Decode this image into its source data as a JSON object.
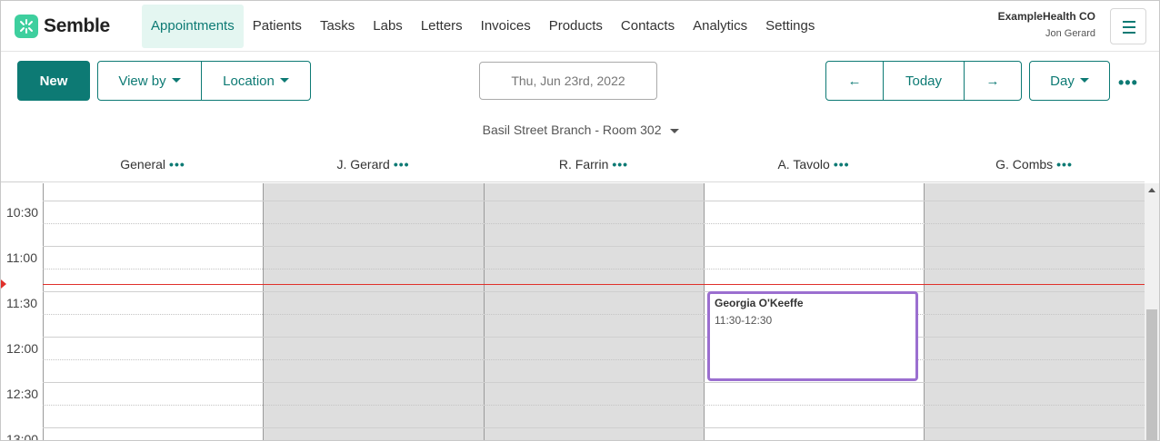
{
  "brand": {
    "name": "Semble",
    "accent": "#0d7a74",
    "logo_color": "#3ecf9e"
  },
  "nav": {
    "items": [
      "Appointments",
      "Patients",
      "Tasks",
      "Labs",
      "Letters",
      "Invoices",
      "Products",
      "Contacts",
      "Analytics",
      "Settings"
    ],
    "active": "Appointments"
  },
  "account": {
    "org": "ExampleHealth CO",
    "user": "Jon Gerard"
  },
  "toolbar": {
    "new_label": "New",
    "view_by_label": "View by",
    "location_label": "Location",
    "date": "Thu, Jun 23rd, 2022",
    "prev_label": "←",
    "today_label": "Today",
    "next_label": "→",
    "view_mode": "Day",
    "more_label": "•••"
  },
  "location_title": "Basil Street Branch - Room 302",
  "columns": [
    {
      "name": "General",
      "dots": "•••",
      "unavailable": false
    },
    {
      "name": "J. Gerard",
      "dots": "•••",
      "unavailable": true
    },
    {
      "name": "R. Farrin",
      "dots": "•••",
      "unavailable": true
    },
    {
      "name": "A. Tavolo",
      "dots": "•••",
      "unavailable": false
    },
    {
      "name": "G. Combs",
      "dots": "•••",
      "unavailable": true
    }
  ],
  "times": [
    "10:30",
    "11:00",
    "11:30",
    "12:00",
    "12:30",
    "13:00"
  ],
  "current_time_color": "#e0302b",
  "appointment": {
    "name": "Georgia O'Keeffe",
    "time": "11:30-12:30",
    "color": "#9b6fd0"
  }
}
